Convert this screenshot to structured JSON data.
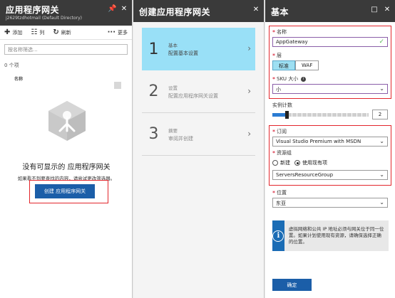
{
  "blade1": {
    "title": "应用程序网关",
    "subtitle": "j2629tzdhotmail (Default Directory)",
    "controls": [
      "📌",
      "✕"
    ],
    "toolbar": {
      "add_icon": "✚",
      "add": "添加",
      "columns_icon": "☷",
      "columns": "列",
      "refresh_icon": "↻",
      "refresh": "刷新",
      "more_icon": "···",
      "more": "更多"
    },
    "filter_placeholder": "按名称筛选...",
    "count": "0 个项",
    "column_name": "名称",
    "empty_title": "没有可显示的 应用程序网关",
    "empty_hint": "如果看不到要查找的内容，请尝试更改筛选器。",
    "create_button": "创建 应用程序网关",
    "icon_name": "application-gateway-icon"
  },
  "blade2": {
    "title": "创建应用程序网关",
    "close": "✕",
    "steps": [
      {
        "num": "1",
        "title": "基本",
        "desc": "配置基本设置",
        "active": true
      },
      {
        "num": "2",
        "title": "设置",
        "desc": "配置应用程序网关设置",
        "active": false
      },
      {
        "num": "3",
        "title": "摘要",
        "desc": "审阅并创建",
        "active": false
      }
    ],
    "chevron": "›"
  },
  "blade3": {
    "title": "基本",
    "controls": [
      "□",
      "✕"
    ],
    "name_label": "名称",
    "name_value": "AppGateway",
    "tier_label": "层",
    "tier_options": [
      "标准",
      "WAF"
    ],
    "tier_selected": "标准",
    "sku_label": "SKU 大小",
    "sku_value": "小",
    "instance_label": "实例计数",
    "instance_value": "2",
    "instance_fraction": 0.15,
    "subscription_label": "订阅",
    "subscription_value": "Visual Studio Premium with MSDN",
    "rg_label": "资源组",
    "rg_new": "新建",
    "rg_existing": "使用现有项",
    "rg_value": "ServersResourceGroup",
    "location_label": "位置",
    "location_value": "东亚",
    "info_text": "虚拟网络和公共 IP 地址必须与网关位于同一位置。如果计划使用现有资源，请确保选择正确的位置。",
    "ok_button": "确定",
    "required_mark": "*",
    "caret": "⌄",
    "check": "✓",
    "info_glyph": "i"
  },
  "colors": {
    "header": "#3a3a3a",
    "accent": "#1b5ea8",
    "active_step": "#99e0f7",
    "highlight_red": "#e3262c",
    "valid_check": "#5cb85c"
  }
}
